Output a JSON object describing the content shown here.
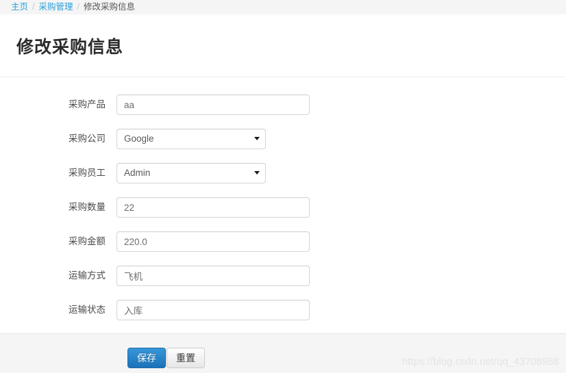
{
  "breadcrumb": {
    "separator": "/",
    "items": [
      {
        "label": "主页",
        "is_link": true
      },
      {
        "label": "采购管理",
        "is_link": true
      },
      {
        "label": "修改采购信息",
        "is_link": false
      }
    ]
  },
  "page": {
    "title": "修改采购信息"
  },
  "form": {
    "fields": [
      {
        "label": "采购产品",
        "type": "text",
        "value": "aa"
      },
      {
        "label": "采购公司",
        "type": "select",
        "value": "Google",
        "options": [
          "Google"
        ]
      },
      {
        "label": "采购员工",
        "type": "select",
        "value": "Admin",
        "options": [
          "Admin"
        ]
      },
      {
        "label": "采购数量",
        "type": "text",
        "value": "22"
      },
      {
        "label": "采购金额",
        "type": "text",
        "value": "220.0"
      },
      {
        "label": "运输方式",
        "type": "text",
        "value": "飞机"
      },
      {
        "label": "运输状态",
        "type": "text",
        "value": "入库"
      }
    ]
  },
  "footer": {
    "save_label": "保存",
    "reset_label": "重置"
  },
  "watermark": {
    "text": "https://blog.csdn.net/qq_43708988"
  },
  "colors": {
    "breadcrumb_link": "#2b9fd9",
    "breadcrumb_current": "#555555",
    "breadcrumb_bg": "#f5f5f5",
    "primary_button": "#1b72b9",
    "page_bg": "#ffffff",
    "footer_bg": "#f5f5f5",
    "input_border": "#d4d4d4",
    "watermark": "#e4e4e4"
  }
}
